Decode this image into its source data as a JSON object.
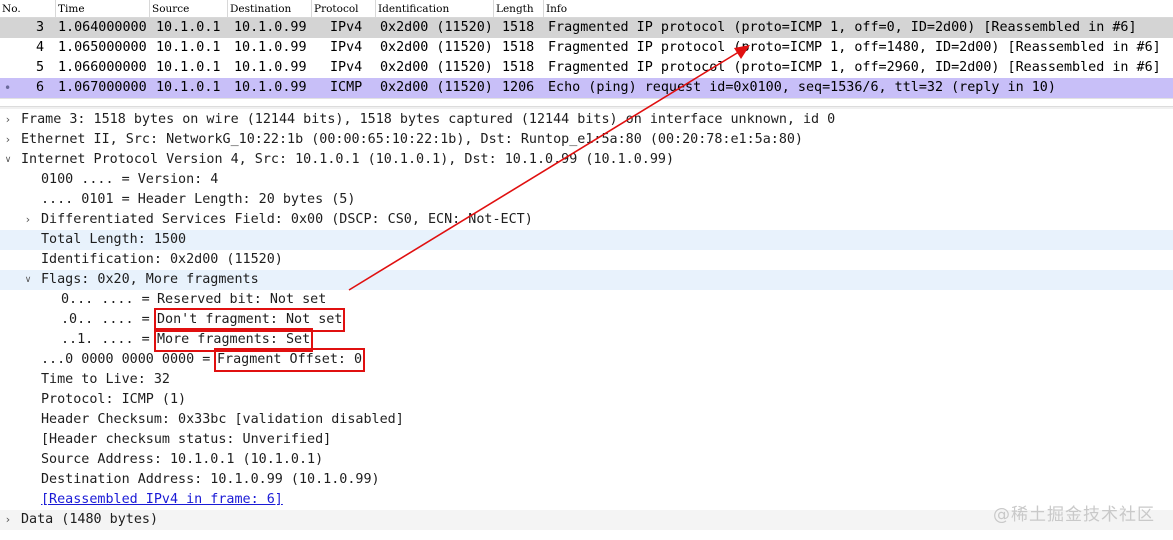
{
  "packet_list": {
    "columns": [
      "No.",
      "Time",
      "Source",
      "Destination",
      "Protocol",
      "Identification",
      "Length",
      "Info"
    ],
    "rows": [
      {
        "no": "3",
        "time": "1.064000000",
        "source": "10.1.0.1",
        "destination": "10.1.0.99",
        "protocol": "IPv4",
        "identification": "0x2d00 (11520)",
        "length": "1518",
        "info": "Fragmented IP protocol (proto=ICMP 1, off=0, ID=2d00) [Reassembled in #6]"
      },
      {
        "no": "4",
        "time": "1.065000000",
        "source": "10.1.0.1",
        "destination": "10.1.0.99",
        "protocol": "IPv4",
        "identification": "0x2d00 (11520)",
        "length": "1518",
        "info": "Fragmented IP protocol (proto=ICMP 1, off=1480, ID=2d00) [Reassembled in #6]"
      },
      {
        "no": "5",
        "time": "1.066000000",
        "source": "10.1.0.1",
        "destination": "10.1.0.99",
        "protocol": "IPv4",
        "identification": "0x2d00 (11520)",
        "length": "1518",
        "info": "Fragmented IP protocol (proto=ICMP 1, off=2960, ID=2d00) [Reassembled in #6]"
      },
      {
        "no": "6",
        "time": "1.067000000",
        "source": "10.1.0.1",
        "destination": "10.1.0.99",
        "protocol": "ICMP",
        "identification": "0x2d00 (11520)",
        "length": "1206",
        "info": "Echo (ping) request  id=0x0100, seq=1536/6, ttl=32 (reply in 10)"
      }
    ]
  },
  "detail": {
    "frame": "Frame 3: 1518 bytes on wire (12144 bits), 1518 bytes captured (12144 bits) on interface unknown, id 0",
    "ethernet": "Ethernet II, Src: NetworkG_10:22:1b (00:00:65:10:22:1b), Dst: Runtop_e1:5a:80 (00:20:78:e1:5a:80)",
    "ip": "Internet Protocol Version 4, Src: 10.1.0.1 (10.1.0.1), Dst: 10.1.0.99 (10.1.0.99)",
    "version": "0100 .... = Version: 4",
    "header_length": ".... 0101 = Header Length: 20 bytes (5)",
    "dsfield": "Differentiated Services Field: 0x00 (DSCP: CS0, ECN: Not-ECT)",
    "total_length": "Total Length: 1500",
    "identification": "Identification: 0x2d00 (11520)",
    "flags": "Flags: 0x20, More fragments",
    "reserved_bits": "0... .... = ",
    "reserved_label": "Reserved bit: Not set",
    "df_bits": ".0.. .... = ",
    "df_label": "Don't fragment: Not set",
    "mf_bits": "..1. .... = ",
    "mf_label": "More fragments: Set",
    "offset_bits": "...0 0000 0000 0000 = ",
    "offset_label": "Fragment Offset: 0",
    "ttl": "Time to Live: 32",
    "protocol": "Protocol: ICMP (1)",
    "checksum": "Header Checksum: 0x33bc [validation disabled]",
    "checksum_status": "[Header checksum status: Unverified]",
    "src_addr": "Source Address: 10.1.0.1 (10.1.0.1)",
    "dst_addr": "Destination Address: 10.1.0.99 (10.1.0.99)",
    "reassembled": "[Reassembled IPv4 in frame: 6]",
    "data": "Data (1480 bytes)"
  },
  "watermark": "@稀土掘金技术社区",
  "colors": {
    "selected_row": "#c8bff8",
    "marked_row": "#d4d4d4",
    "tree_highlight": "#e8f2fc",
    "annotation_red": "#e01010",
    "link_blue": "#1a1ad6"
  }
}
